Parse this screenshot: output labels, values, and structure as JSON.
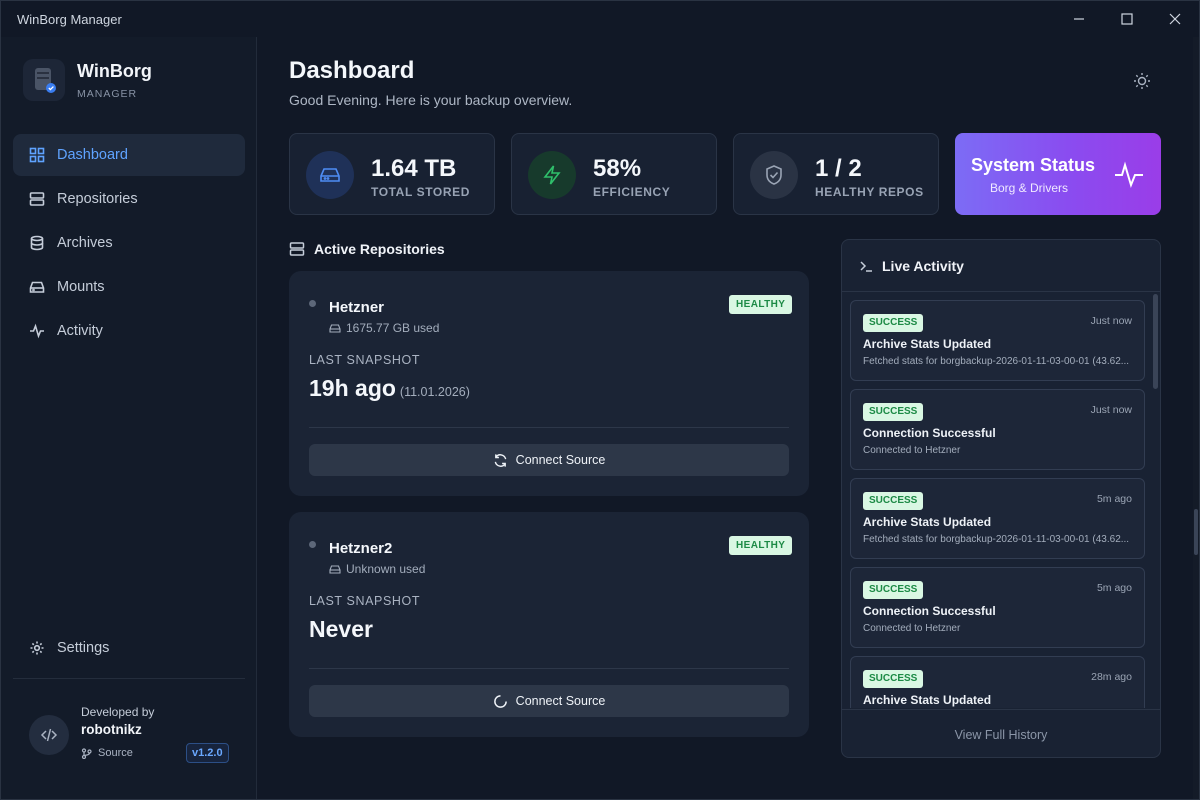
{
  "window": {
    "title": "WinBorg Manager"
  },
  "brand": {
    "title": "WinBorg",
    "subtitle": "MANAGER"
  },
  "nav": {
    "items": [
      {
        "label": "Dashboard",
        "icon": "grid-icon",
        "active": true
      },
      {
        "label": "Repositories",
        "icon": "server-icon",
        "active": false
      },
      {
        "label": "Archives",
        "icon": "database-icon",
        "active": false
      },
      {
        "label": "Mounts",
        "icon": "drive-icon",
        "active": false
      },
      {
        "label": "Activity",
        "icon": "pulse-icon",
        "active": false
      }
    ],
    "settings_label": "Settings"
  },
  "developer": {
    "by": "Developed by",
    "name": "robotnikz",
    "source_label": "Source",
    "version": "v1.2.0"
  },
  "header": {
    "title": "Dashboard",
    "subtitle": "Good Evening. Here is your backup overview."
  },
  "stats": [
    {
      "value": "1.64 TB",
      "label": "TOTAL STORED",
      "icon": "hard-drive-icon",
      "color": "#4f8df5"
    },
    {
      "value": "58%",
      "label": "EFFICIENCY",
      "icon": "lightning-icon",
      "color": "#2fbf6b"
    },
    {
      "value": "1 / 2",
      "label": "HEALTHY REPOS",
      "icon": "shield-check-icon",
      "color": "#9aa4b4"
    }
  ],
  "system_status": {
    "title": "System Status",
    "subtitle": "Borg & Drivers"
  },
  "active_repositories": {
    "title": "Active Repositories",
    "repos": [
      {
        "name": "Hetzner",
        "used": "1675.77 GB used",
        "status": "HEALTHY",
        "snapshot_label": "LAST SNAPSHOT",
        "snapshot_value": "19h ago",
        "snapshot_date": "(11.01.2026)",
        "button": "Connect Source"
      },
      {
        "name": "Hetzner2",
        "used": "Unknown used",
        "status": "HEALTHY",
        "snapshot_label": "LAST SNAPSHOT",
        "snapshot_value": "Never",
        "snapshot_date": "",
        "button": "Connect Source"
      }
    ]
  },
  "live_activity": {
    "title": "Live Activity",
    "items": [
      {
        "status": "SUCCESS",
        "time": "Just now",
        "title": "Archive Stats Updated",
        "desc": "Fetched stats for borgbackup-2026-01-11-03-00-01 (43.62..."
      },
      {
        "status": "SUCCESS",
        "time": "Just now",
        "title": "Connection Successful",
        "desc": "Connected to Hetzner"
      },
      {
        "status": "SUCCESS",
        "time": "5m ago",
        "title": "Archive Stats Updated",
        "desc": "Fetched stats for borgbackup-2026-01-11-03-00-01 (43.62..."
      },
      {
        "status": "SUCCESS",
        "time": "5m ago",
        "title": "Connection Successful",
        "desc": "Connected to Hetzner"
      },
      {
        "status": "SUCCESS",
        "time": "28m ago",
        "title": "Archive Stats Updated",
        "desc": ""
      }
    ],
    "footer": "View Full History"
  }
}
